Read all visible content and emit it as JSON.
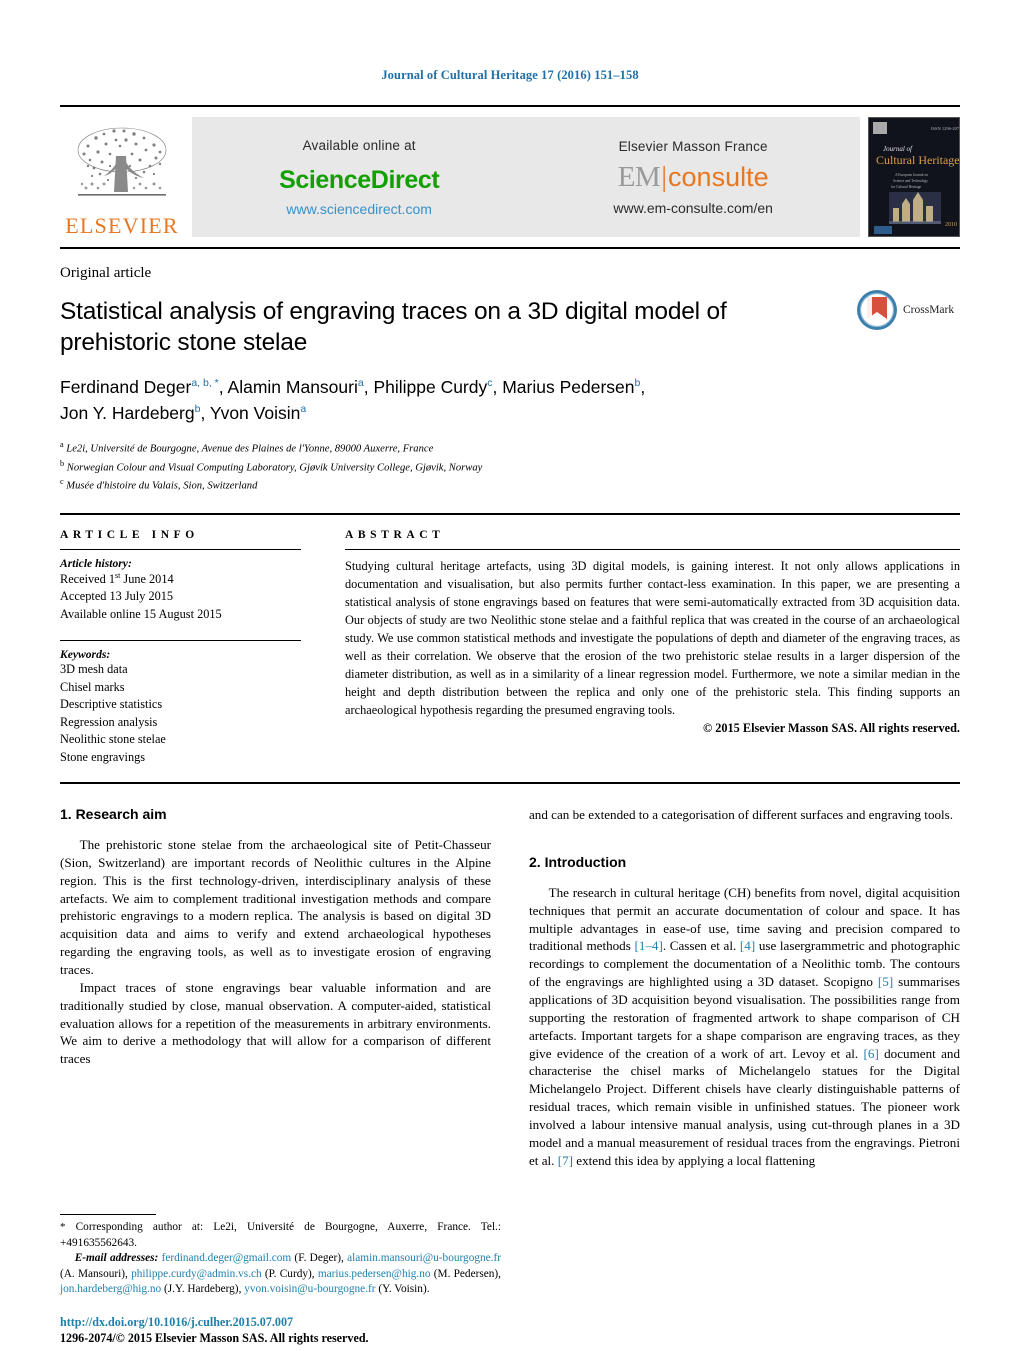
{
  "running_head": "Journal of Cultural Heritage 17 (2016) 151–158",
  "masthead": {
    "publisher_logo_label": "ELSEVIER",
    "sciencedirect": {
      "available_text": "Available online at",
      "brand": "ScienceDirect",
      "url": "www.sciencedirect.com"
    },
    "emconsulte": {
      "heading": "Elsevier Masson France",
      "brand_left": "EM",
      "brand_right": "consulte",
      "url": "www.em-consulte.com/en"
    },
    "cover": {
      "journal_line1": "Journal of",
      "journal_line2": "Cultural Heritage",
      "year": "2010"
    }
  },
  "article": {
    "type": "Original article",
    "title": "Statistical analysis of engraving traces on a 3D digital model of prehistoric stone stelae",
    "crossmark_label": "CrossMark",
    "authors_line1_parts": [
      {
        "name": "Ferdinand Deger",
        "sup": "a, b, *"
      },
      {
        "name": "Alamin Mansouri",
        "sup": "a"
      },
      {
        "name": "Philippe Curdy",
        "sup": "c"
      },
      {
        "name": "Marius Pedersen",
        "sup": "b"
      }
    ],
    "authors_line2_parts": [
      {
        "name": "Jon Y. Hardeberg",
        "sup": "b"
      },
      {
        "name": "Yvon Voisin",
        "sup": "a"
      }
    ],
    "affiliations": [
      {
        "mark": "a",
        "text": "Le2i, Université de Bourgogne, Avenue des Plaines de l'Yonne, 89000 Auxerre, France"
      },
      {
        "mark": "b",
        "text": "Norwegian Colour and Visual Computing Laboratory, Gjøvik University College, Gjøvik, Norway"
      },
      {
        "mark": "c",
        "text": "Musée d'histoire du Valais, Sion, Switzerland"
      }
    ]
  },
  "article_info": {
    "heading": "ARTICLE INFO",
    "history_label": "Article history:",
    "history": [
      "Received 1st June 2014",
      "Accepted 13 July 2015",
      "Available online 15 August 2015"
    ],
    "received_prefix": "Received 1",
    "received_sup": "st",
    "received_suffix": " June 2014",
    "keywords_label": "Keywords:",
    "keywords": [
      "3D mesh data",
      "Chisel marks",
      "Descriptive statistics",
      "Regression analysis",
      "Neolithic stone stelae",
      "Stone engravings"
    ]
  },
  "abstract": {
    "heading": "ABSTRACT",
    "text": "Studying cultural heritage artefacts, using 3D digital models, is gaining interest. It not only allows applications in documentation and visualisation, but also permits further contact-less examination. In this paper, we are presenting a statistical analysis of stone engravings based on features that were semi-automatically extracted from 3D acquisition data. Our objects of study are two Neolithic stone stelae and a faithful replica that was created in the course of an archaeological study. We use common statistical methods and investigate the populations of depth and diameter of the engraving traces, as well as their correlation. We observe that the erosion of the two prehistoric stelae results in a larger dispersion of the diameter distribution, as well as in a similarity of a linear regression model. Furthermore, we note a similar median in the height and depth distribution between the replica and only one of the prehistoric stela. This finding supports an archaeological hypothesis regarding the presumed engraving tools.",
    "copyright": "© 2015 Elsevier Masson SAS. All rights reserved."
  },
  "body": {
    "section1_heading": "1. Research aim",
    "section1_p1": "The prehistoric stone stelae from the archaeological site of Petit-Chasseur (Sion, Switzerland) are important records of Neolithic cultures in the Alpine region. This is the first technology-driven, interdisciplinary analysis of these artefacts. We aim to complement traditional investigation methods and compare prehistoric engravings to a modern replica. The analysis is based on digital 3D acquisition data and aims to verify and extend archaeological hypotheses regarding the engraving tools, as well as to investigate erosion of engraving traces.",
    "section1_p2": "Impact traces of stone engravings bear valuable information and are traditionally studied by close, manual observation. A computer-aided, statistical evaluation allows for a repetition of the measurements in arbitrary environments. We aim to derive a methodology that will allow for a comparison of different traces",
    "section1_cont": "and can be extended to a categorisation of different surfaces and engraving tools.",
    "section2_heading": "2. Introduction",
    "section2_p1_a": "The research in cultural heritage (CH) benefits from novel, digital acquisition techniques that permit an accurate documentation of colour and space. It has multiple advantages in ease-of use, time saving and precision compared to traditional methods ",
    "section2_ref1": "[1–4]",
    "section2_p1_b": ". Cassen et al. ",
    "section2_ref2": "[4]",
    "section2_p1_c": " use lasergrammetric and photographic recordings to complement the documentation of a Neolithic tomb. The contours of the engravings are highlighted using a 3D dataset. Scopigno ",
    "section2_ref3": "[5]",
    "section2_p1_d": " summarises applications of 3D acquisition beyond visualisation. The possibilities range from supporting the restoration of fragmented artwork to shape comparison of CH artefacts. Important targets for a shape comparison are engraving traces, as they give evidence of the creation of a work of art. Levoy et al. ",
    "section2_ref4": "[6]",
    "section2_p1_e": " document and characterise the chisel marks of Michelangelo statues for the Digital Michelangelo Project. Different chisels have clearly distinguishable patterns of residual traces, which remain visible in unfinished statues. The pioneer work involved a labour intensive manual analysis, using cut-through planes in a 3D model and a manual measurement of residual traces from the engravings. Pietroni et al. ",
    "section2_ref5": "[7]",
    "section2_p1_f": " extend this idea by applying a local flattening"
  },
  "footnote": {
    "star": "*",
    "corresponding": " Corresponding author at: Le2i, Université de Bourgogne, Auxerre, France. Tel.: +491635562643.",
    "email_label": "E-mail addresses:",
    "emails": [
      {
        "addr": "ferdinand.deger@gmail.com",
        "who": " (F. Deger), "
      },
      {
        "addr": "alamin.mansouri@u-bourgogne.fr",
        "who": " (A. Mansouri), "
      },
      {
        "addr": "philippe.curdy@admin.vs.ch",
        "who": " (P. Curdy), "
      },
      {
        "addr": "marius.pedersen@hig.no",
        "who": " (M. Pedersen), "
      },
      {
        "addr": "jon.hardeberg@hig.no",
        "who": " (J.Y. Hardeberg), "
      },
      {
        "addr": "yvon.voisin@u-bourgogne.fr",
        "who": " (Y. Voisin)."
      }
    ],
    "doi": "http://dx.doi.org/10.1016/j.culher.2015.07.007",
    "issn": "1296-2074/© 2015 Elsevier Masson SAS. All rights reserved."
  },
  "colors": {
    "link": "#1f7fad",
    "elsevier_orange": "#e87722",
    "sciencedirect_green": "#12a000",
    "banner_bg": "#e8e8e8"
  }
}
